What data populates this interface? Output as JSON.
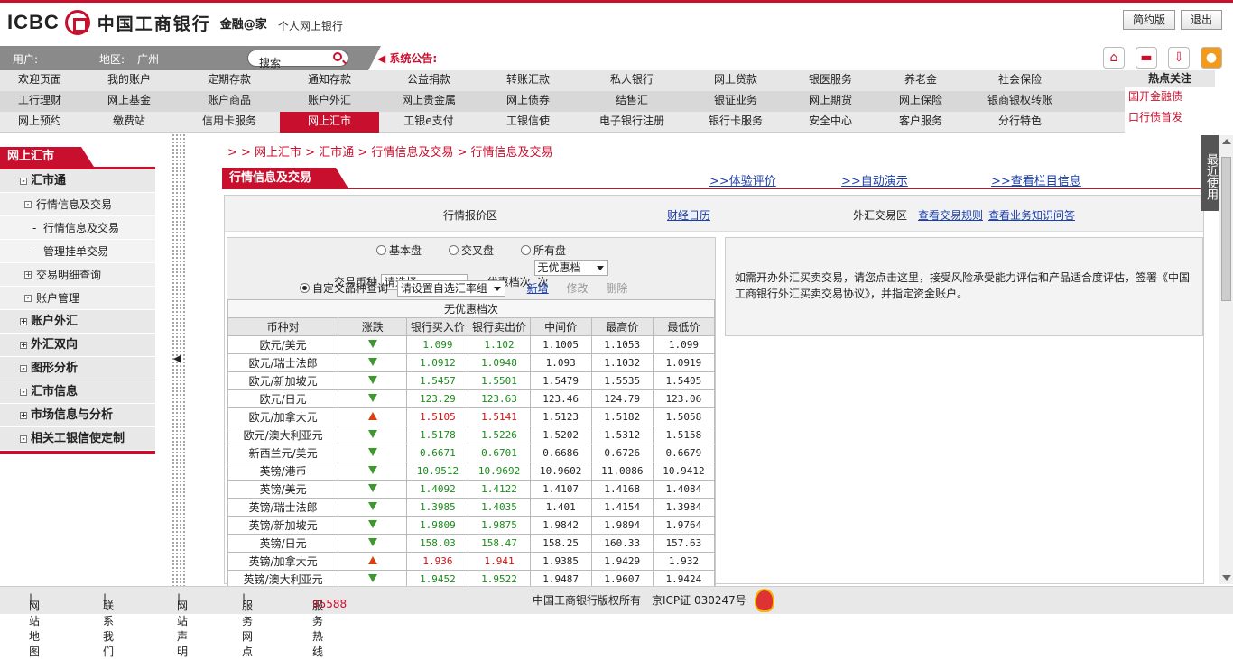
{
  "header": {
    "logo_en": "ICBC",
    "logo_cn": "中国工商银行",
    "brand": "金融@家",
    "product": "个人网上银行",
    "simple_btn": "简约版",
    "logout_btn": "退出"
  },
  "userbar": {
    "user_label": "用户:",
    "region_label": "地区:",
    "region": "广州",
    "search_placeholder": "搜索",
    "notice": "系统公告:"
  },
  "nav": {
    "row1": [
      "欢迎页面",
      "我的账户",
      "定期存款",
      "通知存款",
      "公益捐款",
      "转账汇款",
      "私人银行",
      "网上贷款",
      "银医服务",
      "养老金",
      "社会保险"
    ],
    "row2": [
      "工行理财",
      "网上基金",
      "账户商品",
      "账户外汇",
      "网上贵金属",
      "网上债券",
      "结售汇",
      "银证业务",
      "网上期货",
      "网上保险",
      "银商银权转账"
    ],
    "row3": [
      "网上预约",
      "缴费站",
      "信用卡服务",
      "网上汇市",
      "工银e支付",
      "工银信使",
      "电子银行注册",
      "银行卡服务",
      "安全中心",
      "客户服务",
      "分行特色"
    ],
    "active": "网上汇市"
  },
  "hot": {
    "title": "热点关注",
    "links": [
      "国开金融债",
      "口行债首发"
    ]
  },
  "left": {
    "title": "网上汇市",
    "items": [
      {
        "label": "汇市通",
        "level": "b",
        "pm": "-"
      },
      {
        "label": "行情信息及交易",
        "level": "s",
        "pm": "-"
      },
      {
        "label": "行情信息及交易",
        "level": "ss"
      },
      {
        "label": "管理挂单交易",
        "level": "ss"
      },
      {
        "label": "交易明细查询",
        "level": "s",
        "pm": "+"
      },
      {
        "label": "账户管理",
        "level": "s",
        "pm": "-"
      },
      {
        "label": "账户外汇",
        "level": "b",
        "pm": "+"
      },
      {
        "label": "外汇双向",
        "level": "b",
        "pm": "+"
      },
      {
        "label": "图形分析",
        "level": "b",
        "pm": "-"
      },
      {
        "label": "汇市信息",
        "level": "b",
        "pm": "-"
      },
      {
        "label": "市场信息与分析",
        "level": "b",
        "pm": "+"
      },
      {
        "label": "相关工银信使定制",
        "level": "b",
        "pm": "-"
      }
    ]
  },
  "breadcrumb": "> > 网上汇市 > 汇市通 > 行情信息及交易 > 行情信息及交易",
  "section": {
    "title": "行情信息及交易",
    "links": [
      ">>体验评价",
      ">>自动演示",
      ">>查看栏目信息"
    ]
  },
  "panel": {
    "quote_area": "行情报价区",
    "calendar": "财经日历",
    "trade_area": "外汇交易区",
    "rules": "查看交易规则",
    "faq": "查看业务知识问答",
    "radios": [
      "基本盘",
      "交叉盘",
      "所有盘"
    ],
    "currency_label": "交易币种",
    "currency_value": "请选择",
    "discount_label": "优惠档次",
    "discount_value": "无优惠档次",
    "custom_label": "自定义品种查询",
    "custom_value": "请设置自选汇率组",
    "add": "新增",
    "edit": "修改",
    "del": "删除",
    "info": "如需开办外汇买卖交易，请您点击这里，接受风险承受能力评估和产品适合度评估，签署《中国工商银行外汇买卖交易协议》，并指定资金账户。"
  },
  "table": {
    "caption": "无优惠档次",
    "headers": [
      "币种对",
      "涨跌",
      "银行买入价",
      "银行卖出价",
      "中间价",
      "最高价",
      "最低价"
    ],
    "rows": [
      [
        "欧元/美元",
        "down",
        "1.099",
        "1.102",
        "1.1005",
        "1.1053",
        "1.099"
      ],
      [
        "欧元/瑞士法郎",
        "down",
        "1.0912",
        "1.0948",
        "1.093",
        "1.1032",
        "1.0919"
      ],
      [
        "欧元/新加坡元",
        "down",
        "1.5457",
        "1.5501",
        "1.5479",
        "1.5535",
        "1.5405"
      ],
      [
        "欧元/日元",
        "down",
        "123.29",
        "123.63",
        "123.46",
        "124.79",
        "123.06"
      ],
      [
        "欧元/加拿大元",
        "up",
        "1.5105",
        "1.5141",
        "1.5123",
        "1.5182",
        "1.5058"
      ],
      [
        "欧元/澳大利亚元",
        "down",
        "1.5178",
        "1.5226",
        "1.5202",
        "1.5312",
        "1.5158"
      ],
      [
        "新西兰元/美元",
        "down",
        "0.6671",
        "0.6701",
        "0.6686",
        "0.6726",
        "0.6679"
      ],
      [
        "英镑/港币",
        "down",
        "10.9512",
        "10.9692",
        "10.9602",
        "11.0086",
        "10.9412"
      ],
      [
        "英镑/美元",
        "down",
        "1.4092",
        "1.4122",
        "1.4107",
        "1.4168",
        "1.4084"
      ],
      [
        "英镑/瑞士法郎",
        "down",
        "1.3985",
        "1.4035",
        "1.401",
        "1.4154",
        "1.3984"
      ],
      [
        "英镑/新加坡元",
        "down",
        "1.9809",
        "1.9875",
        "1.9842",
        "1.9894",
        "1.9764"
      ],
      [
        "英镑/日元",
        "down",
        "158.03",
        "158.47",
        "158.25",
        "160.33",
        "157.63"
      ],
      [
        "英镑/加拿大元",
        "up",
        "1.936",
        "1.941",
        "1.9385",
        "1.9429",
        "1.932"
      ],
      [
        "英镑/澳大利亚元",
        "down",
        "1.9452",
        "1.9522",
        "1.9487",
        "1.9607",
        "1.9424"
      ]
    ]
  },
  "recent": "最近使用",
  "footer": {
    "links": [
      "网站地图",
      "联系我们",
      "网站声明",
      "服务网点"
    ],
    "hotline_label": "服务热线",
    "hotline": "95588",
    "copyright": "中国工商银行版权所有",
    "icp": "京ICP证 030247号"
  },
  "colors": {
    "brand_red": "#c8102e",
    "up": "#d01010",
    "down": "#1a8a1a",
    "link": "#1a3faa"
  }
}
